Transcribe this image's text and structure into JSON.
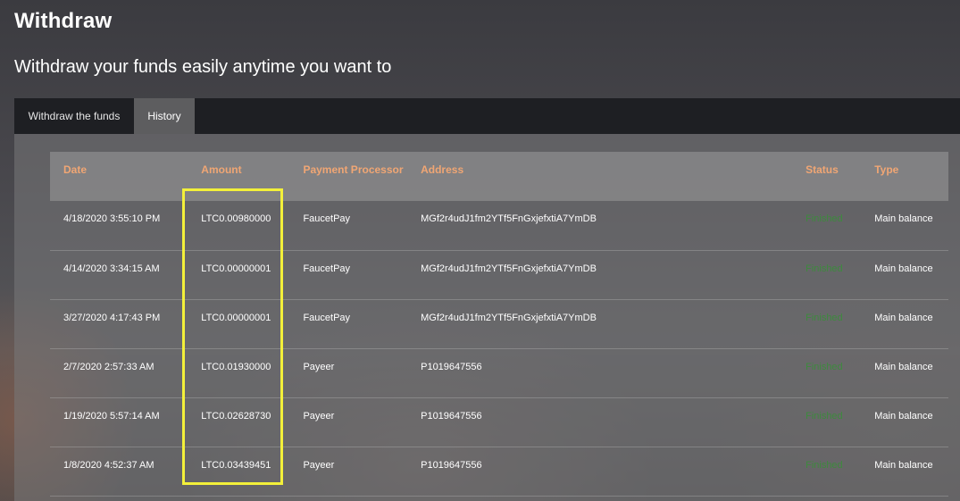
{
  "page": {
    "title": "Withdraw",
    "subtitle": "Withdraw your funds easily anytime you want to"
  },
  "tabs": [
    {
      "label": "Withdraw the funds",
      "active": false
    },
    {
      "label": "History",
      "active": true
    }
  ],
  "table": {
    "headers": {
      "date": "Date",
      "amount": "Amount",
      "processor": "Payment Processor",
      "address": "Address",
      "status": "Status",
      "type": "Type"
    },
    "rows": [
      {
        "date": "4/18/2020 3:55:10 PM",
        "amount": "LTC0.00980000",
        "processor": "FaucetPay",
        "address": "MGf2r4udJ1fm2YTf5FnGxjefxtiA7YmDB",
        "status": "Finished",
        "type": "Main balance"
      },
      {
        "date": "4/14/2020 3:34:15 AM",
        "amount": "LTC0.00000001",
        "processor": "FaucetPay",
        "address": "MGf2r4udJ1fm2YTf5FnGxjefxtiA7YmDB",
        "status": "Finished",
        "type": "Main balance"
      },
      {
        "date": "3/27/2020 4:17:43 PM",
        "amount": "LTC0.00000001",
        "processor": "FaucetPay",
        "address": "MGf2r4udJ1fm2YTf5FnGxjefxtiA7YmDB",
        "status": "Finished",
        "type": "Main balance"
      },
      {
        "date": "2/7/2020 2:57:33 AM",
        "amount": "LTC0.01930000",
        "processor": "Payeer",
        "address": "P1019647556",
        "status": "Finished",
        "type": "Main balance"
      },
      {
        "date": "1/19/2020 5:57:14 AM",
        "amount": "LTC0.02628730",
        "processor": "Payeer",
        "address": "P1019647556",
        "status": "Finished",
        "type": "Main balance"
      },
      {
        "date": "1/8/2020 4:52:37 AM",
        "amount": "LTC0.03439451",
        "processor": "Payeer",
        "address": "P1019647556",
        "status": "Finished",
        "type": "Main balance"
      }
    ]
  },
  "colors": {
    "header_text": "#f0a674",
    "status_finished": "#3d8a3d",
    "highlight": "#f3f03a"
  }
}
